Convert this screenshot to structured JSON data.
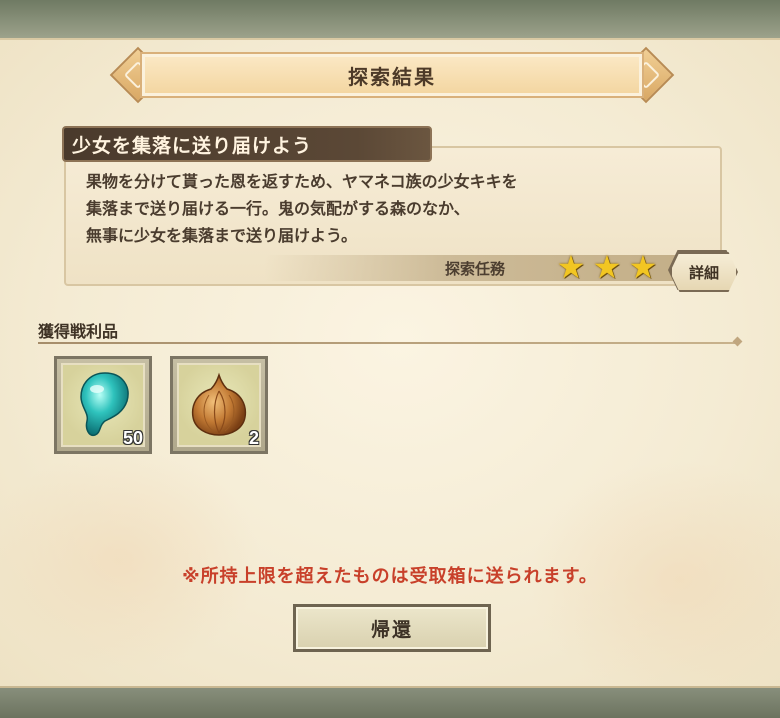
{
  "dialog": {
    "title": "探索結果"
  },
  "mission": {
    "title": "少女を集落に送り届けよう",
    "description": [
      "果物を分けて貰った恩を返すため、ヤマネコ族の少女キキを",
      "集落まで送り届ける一行。鬼の気配がする森のなか、",
      "無事に少女を集落まで送り届けよう。"
    ],
    "type": "探索任務",
    "stars": 3,
    "detail_label": "詳細"
  },
  "loot": {
    "label": "獲得戦利品",
    "items": [
      {
        "icon": "teal-gem-icon",
        "count": "50",
        "color": "#22b3b0"
      },
      {
        "icon": "onion-icon",
        "count": "2",
        "color": "#b9692a"
      }
    ]
  },
  "notice": "※所持上限を超えたものは受取箱に送られます。",
  "return_label": "帰還",
  "colors": {
    "notice": "#c8402a",
    "star": "#f2c622",
    "mission_title_bg": "#4a3a2c"
  }
}
